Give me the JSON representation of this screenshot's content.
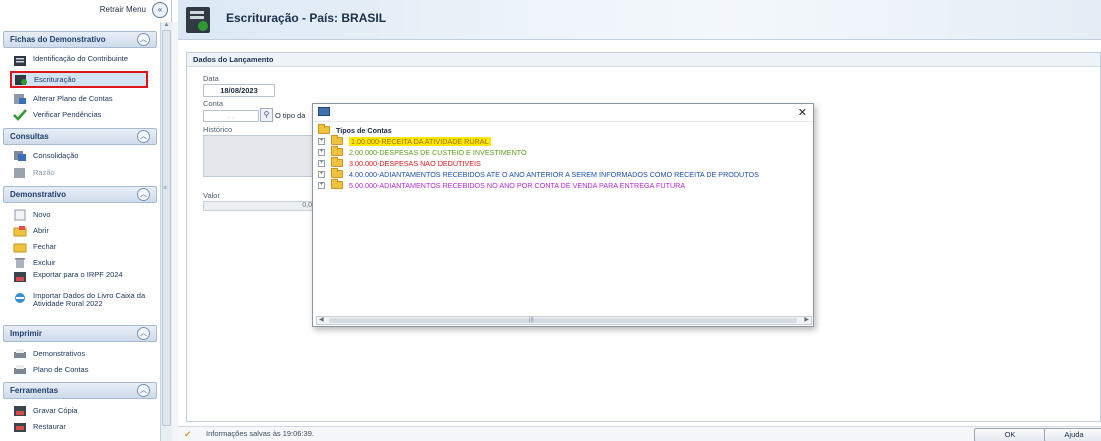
{
  "sidebar": {
    "collapse_label": "Retrair Menu",
    "collapse_icon": "«",
    "sections": {
      "fichas": {
        "title": "Fichas do Demonstrativo",
        "items": [
          "Identificação do Contribuinte",
          "Escrituração",
          "Alterar Plano de Contas",
          "Verificar Pendências"
        ]
      },
      "consultas": {
        "title": "Consultas",
        "items": [
          "Consolidação",
          "Razão"
        ]
      },
      "demonstrativo": {
        "title": "Demonstrativo",
        "items": [
          "Novo",
          "Abrir",
          "Fechar",
          "Excluir",
          "Exportar para o IRPF 2024",
          "Importar Dados do Livro Caixa da Atividade Rural 2022"
        ]
      },
      "imprimir": {
        "title": "Imprimir",
        "items": [
          "Demonstrativos",
          "Plano de Contas"
        ]
      },
      "ferramentas": {
        "title": "Ferramentas",
        "items": [
          "Gravar Cópia",
          "Restaurar"
        ]
      }
    }
  },
  "header": {
    "title": "Escrituração - País: BRASIL"
  },
  "form": {
    "section_title": "Dados do Lançamento",
    "data_label": "Data",
    "data_value": "18/08/2023",
    "conta_label": "Conta",
    "conta_value": ". .",
    "conta_tipo": "O tipo da",
    "historico_label": "Histórico",
    "valor_label": "Valor",
    "valor_value": "0,0"
  },
  "dialog": {
    "root_label": "Tipos de Contas",
    "nodes": [
      "1.00.000-RECEITA DA ATIVIDADE RURAL",
      "2.00.000-DESPESAS DE CUSTEIO E INVESTIMENTO",
      "3.00.000-DESPESAS NAO DEDUTIVEIS",
      "4.00.000-ADIANTAMENTOS RECEBIDOS ATE O ANO ANTERIOR A SEREM INFORMADOS COMO RECEITA DE PRODUTOS",
      "5.00.000-ADIANTAMENTOS RECEBIDOS NO ANO POR CONTA DE VENDA PARA ENTREGA FUTURA"
    ],
    "close_glyph": "✕",
    "node_colors": [
      "#a26d00",
      "#5a9e1c",
      "#d6181c",
      "#2050a8",
      "#b02ad6"
    ],
    "highlight_color": "#ffe800"
  },
  "statusbar": {
    "message": "Informações salvas às 19:06:39.",
    "ok_label": "OK",
    "ajuda_label": "Ajuda"
  },
  "icons": {
    "collapse": "double-chevron-left-icon",
    "section_toggle": "chevron-up-icon",
    "search": "search-icon"
  }
}
